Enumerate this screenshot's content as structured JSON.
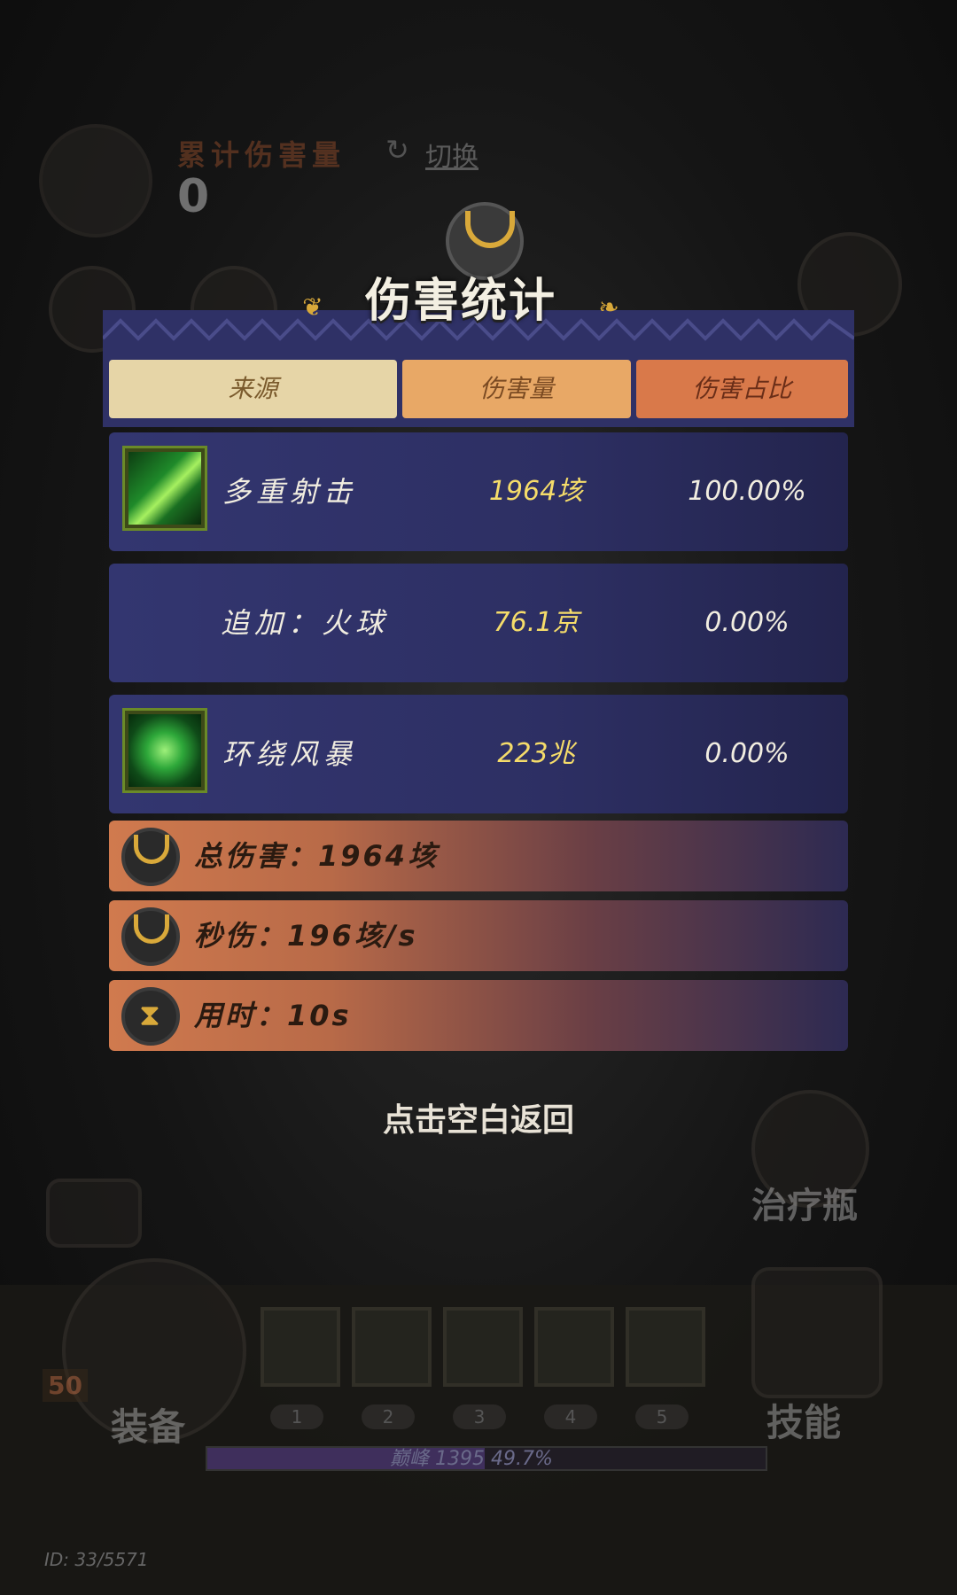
{
  "background": {
    "hud_title": "累计伤害量",
    "hud_value": "0",
    "hud_switch": "切换",
    "potion_label": "治疗瓶",
    "equip_label": "装备",
    "skill_label": "技能",
    "level_badge": "50",
    "slot_numbers": [
      "1",
      "2",
      "3",
      "4",
      "5"
    ],
    "progress_text": "巅峰 1395  49.7%",
    "progress_value": 0.497,
    "player_id": "ID: 33/5571"
  },
  "modal": {
    "title": "伤害统计",
    "tabs": {
      "source": "来源",
      "damage": "伤害量",
      "ratio": "伤害占比"
    },
    "rows": [
      {
        "icon": "multi-shot-icon",
        "name": "多重射击",
        "damage": "1964垓",
        "ratio": "100.00%"
      },
      {
        "name": "追加：火球",
        "damage": "76.1京",
        "ratio": "0.00%"
      },
      {
        "icon": "whirlwind-icon",
        "name": "环绕风暴",
        "damage": "223兆",
        "ratio": "0.00%"
      }
    ],
    "summary": {
      "total": "总伤害：1964垓",
      "dps": "秒伤：196垓/s",
      "time": "用时：10s"
    },
    "tap_back": "点击空白返回"
  },
  "colors": {
    "panel": "#2f3166",
    "tab_source": "#e6d5a7",
    "tab_damage": "#e8a866",
    "tab_ratio": "#d9794a",
    "damage_text": "#f5dc6a",
    "gold": "#d9a93a"
  }
}
